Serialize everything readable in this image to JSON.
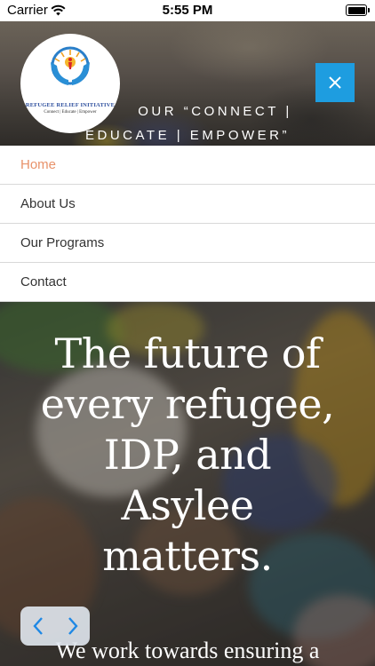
{
  "status_bar": {
    "carrier": "Carrier",
    "time": "5:55 PM"
  },
  "header": {
    "logo": {
      "name": "REFUGEE RELIEF INITIATIVE",
      "tagline": "Connect | Educate | Empower"
    },
    "tagline_line1": "OUR “CONNECT |",
    "tagline_line2": "EDUCATE | EMPOWER”"
  },
  "nav": {
    "items": [
      {
        "label": "Home",
        "active": true
      },
      {
        "label": "About Us",
        "active": false
      },
      {
        "label": "Our Programs",
        "active": false
      },
      {
        "label": "Contact",
        "active": false
      }
    ]
  },
  "hero": {
    "title_lines": [
      "The future of",
      "every refugee,",
      "IDP, and",
      "Asylee",
      "matters."
    ],
    "subtitle": "We work towards ensuring a"
  },
  "colors": {
    "accent": "#1e9de0",
    "active_nav": "#e8926a",
    "logo_blue": "#2d4f9e"
  },
  "icons": {
    "close": "close-icon",
    "prev": "chevron-left-icon",
    "next": "chevron-right-icon",
    "wifi": "wifi-icon",
    "battery": "battery-icon"
  }
}
